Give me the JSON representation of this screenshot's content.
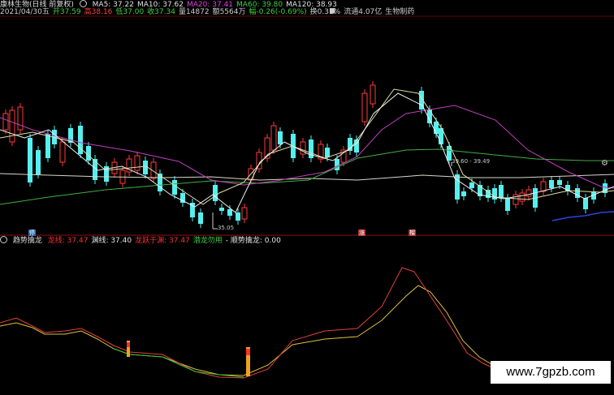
{
  "header": {
    "title": "康林生物(日线 前复权)",
    "ma": [
      {
        "label": "MA5: 37.22",
        "color": "#e0e0e0"
      },
      {
        "label": "MA10: 37.62",
        "color": "#e0e0e0"
      },
      {
        "label": "MA20: 37.41",
        "color": "#e040e0"
      },
      {
        "label": "MA60: 39.80",
        "color": "#40d040"
      },
      {
        "label": "MA120: 38.93",
        "color": "#e0e0e0"
      }
    ],
    "quote": [
      {
        "label": "2021/04/30五",
        "color": "#ccc"
      },
      {
        "label": "开37.59",
        "color": "#40d040"
      },
      {
        "label": "高38.16",
        "color": "#ff4040"
      },
      {
        "label": "低37.00",
        "color": "#40d040"
      },
      {
        "label": "收37.34",
        "color": "#40d040"
      },
      {
        "label": "量14872",
        "color": "#ccc"
      },
      {
        "label": "额5564万",
        "color": "#ccc"
      },
      {
        "label": "幅-0.26(-0.69%)",
        "color": "#40d040"
      },
      {
        "label": "换0.31%",
        "color": "#ccc"
      },
      {
        "label": "流通4.07亿",
        "color": "#ccc"
      },
      {
        "label": "生物制药",
        "color": "#ccc"
      }
    ]
  },
  "price_annotations": {
    "low": "35.05",
    "range": "39.60 - 39.49"
  },
  "badges": [
    {
      "label": "停",
      "color": "#2a6fb0"
    },
    {
      "label": "涨",
      "color": "#b03030"
    },
    {
      "label": "榴",
      "color": "#b03030"
    }
  ],
  "indicator": {
    "name": "趋势擒龙",
    "items": [
      {
        "label": "龙线: 37.47",
        "color": "#ff3030"
      },
      {
        "label": "渊线: 37.40",
        "color": "#e0e0e0"
      },
      {
        "label": "龙跃于渊: 37.47",
        "color": "#ff3030"
      },
      {
        "label": "潜龙勿用",
        "color": "#40d040"
      },
      {
        "label": "- 顺势擒龙: 0.00",
        "color": "#e0e0e0"
      }
    ]
  },
  "watermark": "www.7gpzb.com",
  "chart_data": {
    "type": "candlestick",
    "close_ma": {
      "MA5": 37.22,
      "MA10": 37.62,
      "MA20": 37.41,
      "MA60": 39.8,
      "MA120": 38.93
    }
  }
}
